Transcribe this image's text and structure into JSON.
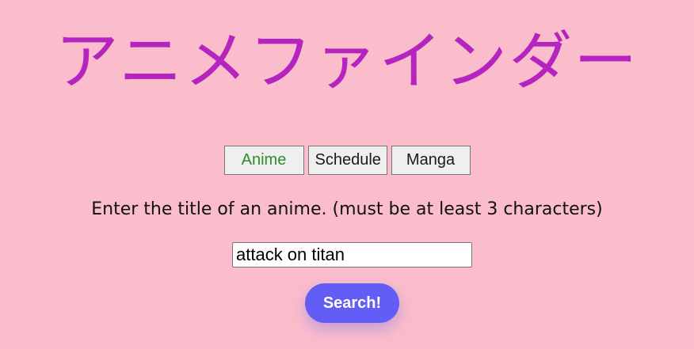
{
  "app": {
    "title": "アニメファインダー"
  },
  "tabs": [
    {
      "label": "Anime",
      "active": true
    },
    {
      "label": "Schedule",
      "active": false
    },
    {
      "label": "Manga",
      "active": false
    }
  ],
  "search": {
    "instruction": "Enter the title of an anime. (must be at least 3 characters)",
    "value": "attack on titan",
    "button_label": "Search!"
  },
  "colors": {
    "background": "#fbbdcb",
    "title": "#b524bf",
    "active_tab_text": "#2e8b2e",
    "button": "#625df5"
  }
}
